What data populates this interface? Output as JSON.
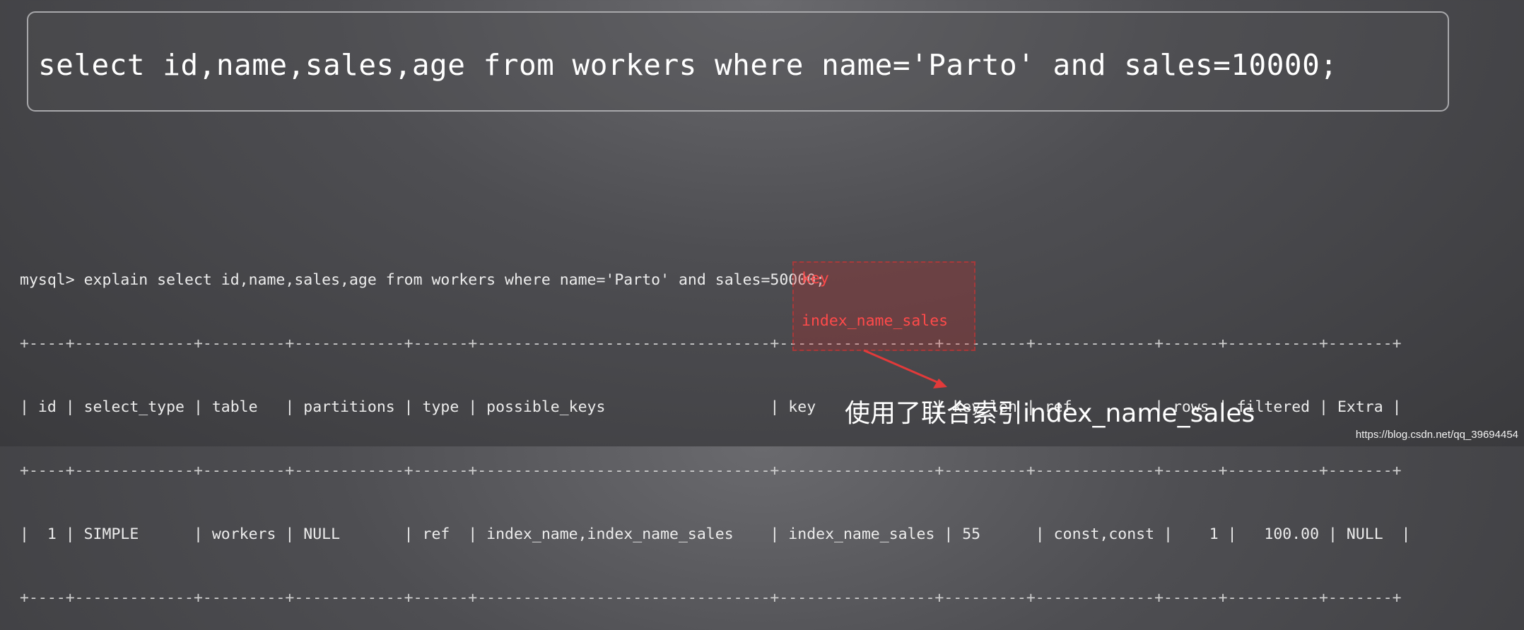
{
  "query_box": {
    "text": "select id,name,sales,age from workers where name='Parto' and sales=10000;"
  },
  "terminal": {
    "command": "mysql> explain select id,name,sales,age from workers where name='Parto' and sales=50000;",
    "border": "+----+-------------+---------+------------+------+--------------------------------+-----------------+---------+-------------+------+----------+-------+",
    "header_row": "| id | select_type | table   | partitions | type | possible_keys                  | key             | key_len | ref         | rows | filtered | Extra |",
    "data_row": "|  1 | SIMPLE      | workers | NULL       | ref  | index_name,index_name_sales    | index_name_sales | 55      | const,const |    1 |   100.00 | NULL  |",
    "highlight_header": "key",
    "highlight_value": "index_name_sales"
  },
  "annotation": {
    "text": "使用了联合索引index_name_sales"
  },
  "watermark": {
    "text": "https://blog.csdn.net/qq_39694454"
  },
  "colors": {
    "highlight": "#ff4a4a",
    "highlight_bg": "#be2828"
  }
}
